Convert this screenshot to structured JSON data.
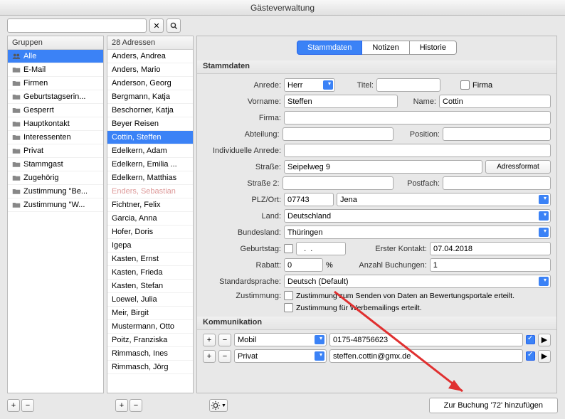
{
  "window": {
    "title": "Gästeverwaltung"
  },
  "search": {
    "placeholder": ""
  },
  "groups": {
    "header": "Gruppen",
    "items": [
      {
        "label": "Alle",
        "sel": true,
        "icon": "people"
      },
      {
        "label": "E-Mail"
      },
      {
        "label": "Firmen"
      },
      {
        "label": "Geburtstagserin..."
      },
      {
        "label": "Gesperrt"
      },
      {
        "label": "Hauptkontakt"
      },
      {
        "label": "Interessenten"
      },
      {
        "label": "Privat"
      },
      {
        "label": "Stammgast"
      },
      {
        "label": "Zugehörig"
      },
      {
        "label": "Zustimmung \"Be..."
      },
      {
        "label": "Zustimmung \"W..."
      }
    ]
  },
  "addresses": {
    "header": "28 Adressen",
    "items": [
      {
        "label": "Anders, Andrea"
      },
      {
        "label": "Anders, Mario"
      },
      {
        "label": "Anderson, Georg"
      },
      {
        "label": "Bergmann, Katja"
      },
      {
        "label": "Beschorner, Katja"
      },
      {
        "label": "Beyer Reisen"
      },
      {
        "label": "Cottin, Steffen",
        "sel": true
      },
      {
        "label": "Edelkern, Adam"
      },
      {
        "label": "Edelkern, Emilia ..."
      },
      {
        "label": "Edelkern, Matthias"
      },
      {
        "label": "Enders, Sebastian",
        "muted": true
      },
      {
        "label": "Fichtner, Felix"
      },
      {
        "label": "Garcia, Anna"
      },
      {
        "label": "Hofer, Doris"
      },
      {
        "label": "Igepa"
      },
      {
        "label": "Kasten, Ernst"
      },
      {
        "label": "Kasten, Frieda"
      },
      {
        "label": "Kasten, Stefan"
      },
      {
        "label": "Loewel, Julia"
      },
      {
        "label": "Meir, Birgit"
      },
      {
        "label": "Mustermann, Otto"
      },
      {
        "label": "Poitz, Franziska"
      },
      {
        "label": "Rimmasch, Ines"
      },
      {
        "label": "Rimmasch, Jörg"
      }
    ]
  },
  "tabs": {
    "t1": "Stammdaten",
    "t2": "Notizen",
    "t3": "Historie"
  },
  "form": {
    "section": "Stammdaten",
    "anrede_lbl": "Anrede:",
    "anrede": "Herr",
    "titel_lbl": "Titel:",
    "titel": "",
    "firma_chk": "Firma",
    "vorname_lbl": "Vorname:",
    "vorname": "Steffen",
    "name_lbl": "Name:",
    "name": "Cottin",
    "firma_lbl": "Firma:",
    "firma": "",
    "abteilung_lbl": "Abteilung:",
    "abteilung": "",
    "position_lbl": "Position:",
    "position": "",
    "indiv_lbl": "Individuelle Anrede:",
    "indiv": "",
    "strasse_lbl": "Straße:",
    "strasse": "Seipelweg 9",
    "adressformat_btn": "Adressformat",
    "strasse2_lbl": "Straße 2:",
    "strasse2": "",
    "postfach_lbl": "Postfach:",
    "postfach": "",
    "plzort_lbl": "PLZ/Ort:",
    "plz": "07743",
    "ort": "Jena",
    "land_lbl": "Land:",
    "land": "Deutschland",
    "bundesland_lbl": "Bundesland:",
    "bundesland": "Thüringen",
    "geburtstag_lbl": "Geburtstag:",
    "geburtstag": "  .  .",
    "erster_kontakt_lbl": "Erster Kontakt:",
    "erster_kontakt": "07.04.2018",
    "rabatt_lbl": "Rabatt:",
    "rabatt": "0",
    "rabatt_unit": "%",
    "anzahl_lbl": "Anzahl Buchungen:",
    "anzahl": "1",
    "sprache_lbl": "Standardsprache:",
    "sprache": "Deutsch (Default)",
    "zustimmung_lbl": "Zustimmung:",
    "zust1": "Zustimmung zum Senden von Daten an Bewertungsportale erteilt.",
    "zust2": "Zustimmung für Werbemailings erteilt."
  },
  "komm": {
    "section": "Kommunikation",
    "r1_type": "Mobil",
    "r1_val": "0175-48756623",
    "r2_type": "Privat",
    "r2_val": "steffen.cottin@gmx.de"
  },
  "footer": {
    "mainbtn": "Zur Buchung '72' hinzufügen"
  }
}
